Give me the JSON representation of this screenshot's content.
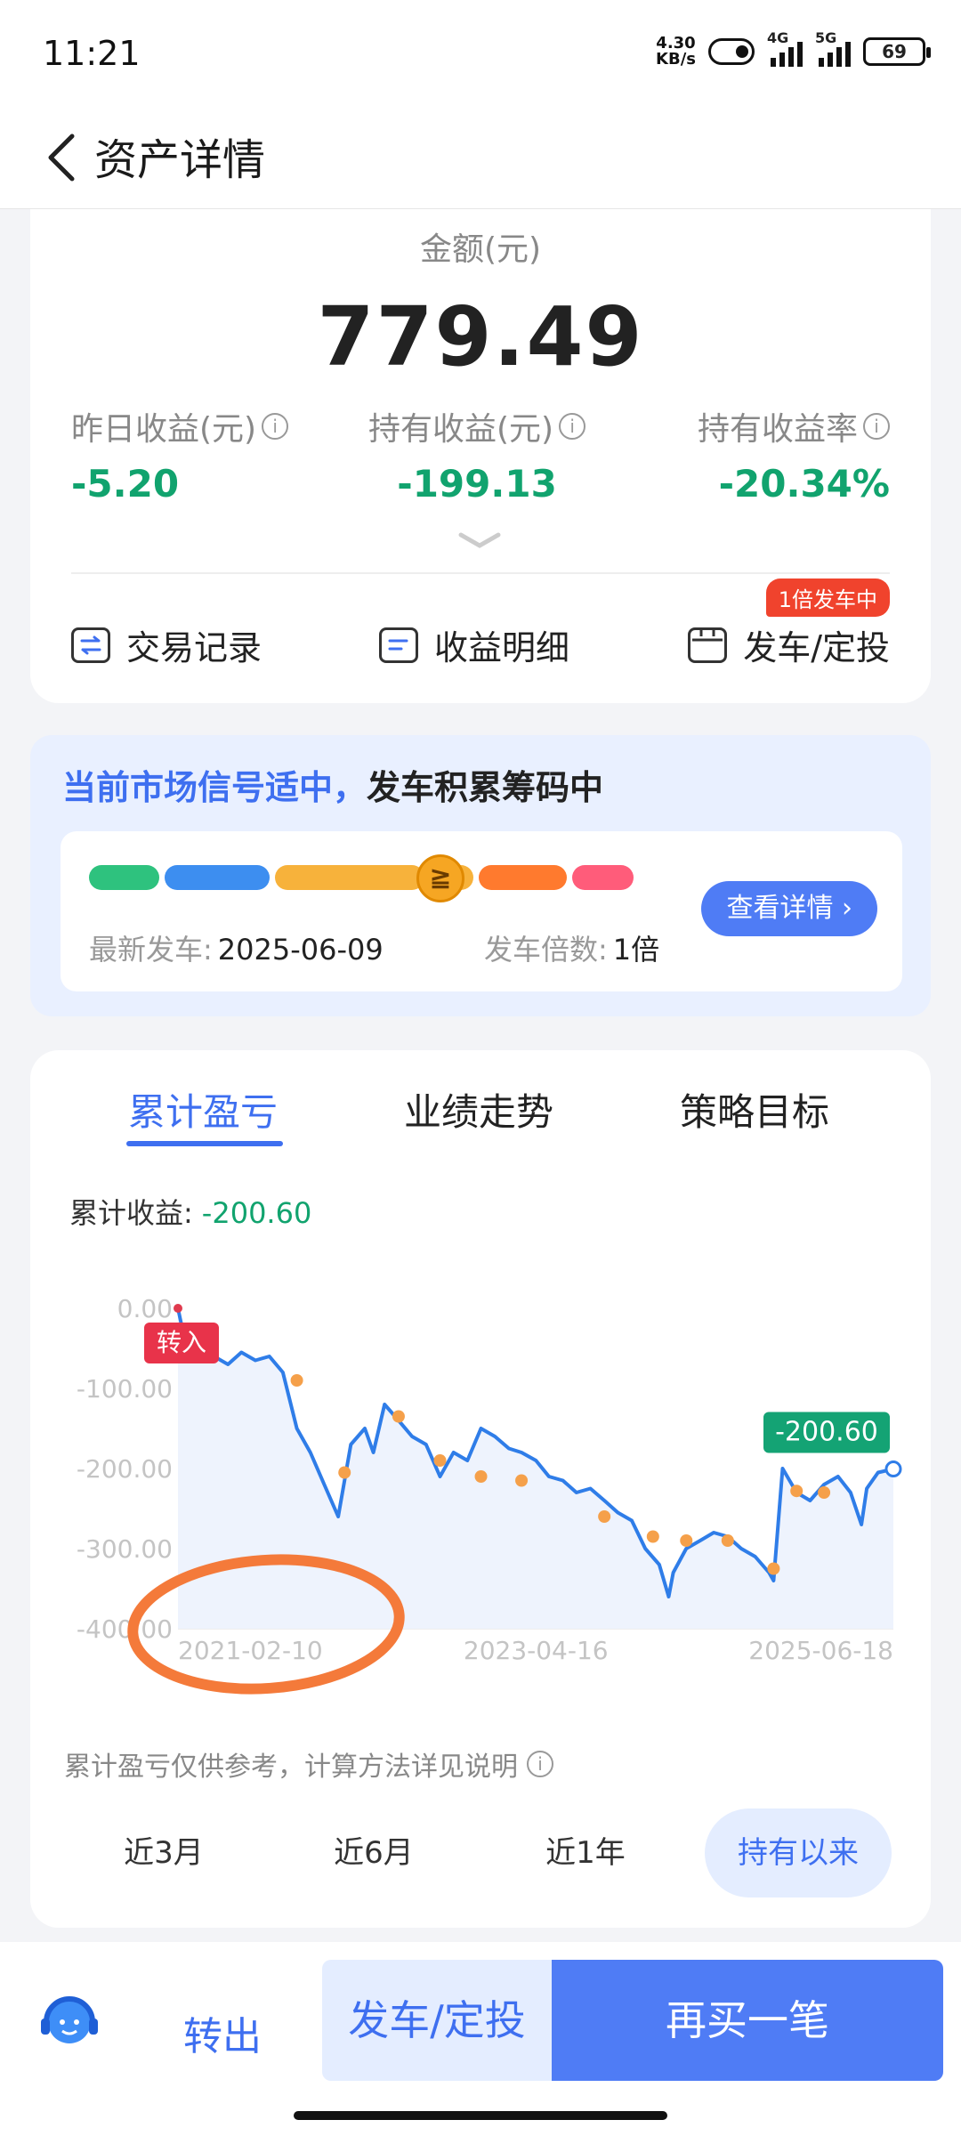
{
  "status": {
    "time": "11:21",
    "net_speed_value": "4.30",
    "net_speed_unit": "KB/s",
    "net1": "4G",
    "net2": "5G",
    "battery": "69"
  },
  "header": {
    "title": "资产详情",
    "back_icon": "chevron-left-icon"
  },
  "summary": {
    "amount_label": "金额(元)",
    "amount": "779.49",
    "metrics": [
      {
        "label": "昨日收益(元)",
        "value": "-5.20"
      },
      {
        "label": "持有收益(元)",
        "value": "-199.13"
      },
      {
        "label": "持有收益率",
        "value": "-20.34%"
      }
    ],
    "actions": [
      {
        "label": "交易记录",
        "icon": "transfer-icon"
      },
      {
        "label": "收益明细",
        "icon": "list-icon"
      },
      {
        "label": "发车/定投",
        "icon": "calendar-icon"
      }
    ],
    "badge": "1倍发车中"
  },
  "signal": {
    "text_blue": "当前市场信号适中，",
    "text_black": "发车积累筹码中",
    "latest_label": "最新发车:",
    "latest_value": "2025-06-09",
    "multiple_label": "发车倍数:",
    "multiple_value": "1倍",
    "detail_button": "查看详情 ›",
    "gauge_colors": [
      "#2ec27e",
      "#3d8ef0",
      "#f7b23b",
      "#f7b23b",
      "#ff7a2e",
      "#ff5c7a"
    ]
  },
  "chart_section": {
    "tabs": [
      "累计盈亏",
      "业绩走势",
      "策略目标"
    ],
    "active_tab": 0,
    "cum_label": "累计收益:",
    "cum_value": "-200.60",
    "note": "累计盈亏仅供参考，计算方法详见说明",
    "ranges": [
      "近3月",
      "近6月",
      "近1年",
      "持有以来"
    ],
    "active_range": 3
  },
  "chart_data": {
    "type": "line",
    "title": "",
    "xlabel": "",
    "ylabel": "",
    "ylim": [
      -400,
      0
    ],
    "y_ticks": [
      "0.00",
      "-100.00",
      "-200.00",
      "-300.00",
      "-400.00"
    ],
    "x_ticks": [
      "2021-02-10",
      "2023-04-16",
      "2025-06-18"
    ],
    "x_range": [
      "2021-02-10",
      "2025-06-18"
    ],
    "start_label": "转入",
    "end_label": "-200.60",
    "line_color": "#2f7de8",
    "marker_color": "#f5a04a",
    "series": [
      {
        "x": [
          "2021-02-10",
          "2021-03-01",
          "2021-04-01",
          "2021-05-01",
          "2021-06-01",
          "2021-07-01",
          "2021-08-01",
          "2021-09-01",
          "2021-10-01",
          "2021-11-01",
          "2021-12-01",
          "2022-01-01",
          "2022-02-01",
          "2022-03-01",
          "2022-04-01",
          "2022-04-20",
          "2022-05-15",
          "2022-06-15",
          "2022-07-15",
          "2022-08-15",
          "2022-09-15",
          "2022-10-15",
          "2022-11-15",
          "2022-12-15",
          "2023-01-15",
          "2023-02-15",
          "2023-03-15",
          "2023-04-16",
          "2023-05-15",
          "2023-06-15",
          "2023-07-15",
          "2023-08-15",
          "2023-09-15",
          "2023-10-15",
          "2023-11-15",
          "2023-12-15",
          "2024-01-15",
          "2024-02-05",
          "2024-02-15",
          "2024-03-15",
          "2024-04-15",
          "2024-05-15",
          "2024-06-15",
          "2024-07-15",
          "2024-08-15",
          "2024-09-15",
          "2024-09-25",
          "2024-10-15",
          "2024-11-15",
          "2024-12-15",
          "2025-01-15",
          "2025-02-15",
          "2025-03-15",
          "2025-04-08",
          "2025-04-20",
          "2025-05-15",
          "2025-06-18"
        ],
        "values": [
          0,
          -50,
          -40,
          -60,
          -70,
          -55,
          -65,
          -60,
          -80,
          -150,
          -180,
          -220,
          -260,
          -170,
          -150,
          -180,
          -120,
          -140,
          -160,
          -170,
          -210,
          -180,
          -190,
          -150,
          -160,
          -175,
          -180,
          -190,
          -210,
          -215,
          -230,
          -225,
          -240,
          -255,
          -265,
          -300,
          -320,
          -360,
          -330,
          -300,
          -290,
          -280,
          -285,
          -300,
          -310,
          -330,
          -340,
          -200,
          -230,
          -240,
          -220,
          -210,
          -230,
          -270,
          -225,
          -205,
          -200.6
        ]
      }
    ],
    "markers": [
      {
        "x": "2021-11-01",
        "y": -90
      },
      {
        "x": "2022-02-15",
        "y": -205
      },
      {
        "x": "2022-06-15",
        "y": -135
      },
      {
        "x": "2022-09-15",
        "y": -190
      },
      {
        "x": "2022-12-15",
        "y": -210
      },
      {
        "x": "2023-03-15",
        "y": -215
      },
      {
        "x": "2023-09-15",
        "y": -260
      },
      {
        "x": "2024-01-01",
        "y": -285
      },
      {
        "x": "2024-03-15",
        "y": -290
      },
      {
        "x": "2024-06-15",
        "y": -290
      },
      {
        "x": "2024-09-25",
        "y": -325
      },
      {
        "x": "2024-11-15",
        "y": -228
      },
      {
        "x": "2025-01-15",
        "y": -230
      }
    ]
  },
  "bottom": {
    "service_icon": "customer-service-icon",
    "out": "转出",
    "invest": "发车/定投",
    "buy": "再买一笔"
  }
}
